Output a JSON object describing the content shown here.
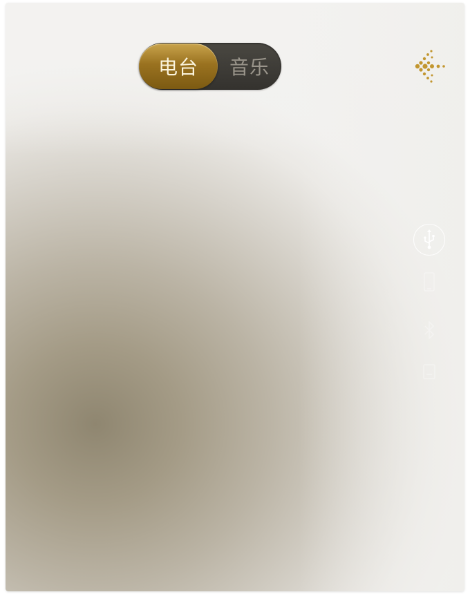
{
  "mode_toggle": {
    "options": [
      "电台",
      "音乐"
    ],
    "selected": "电台"
  },
  "icons": {
    "back": "back-arrow-dots-icon",
    "usb": "usb-icon",
    "source_1": "phone-icon",
    "source_2": "bluetooth-icon",
    "source_3": "sd-card-icon"
  },
  "colors": {
    "accent_gold": "#b08a30",
    "toggle_track": "#3c3a35"
  }
}
